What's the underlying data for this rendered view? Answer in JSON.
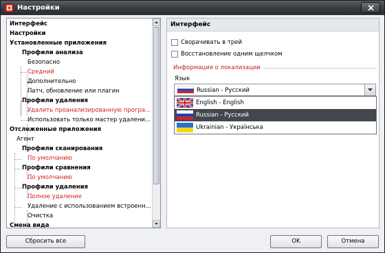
{
  "window": {
    "title": "Настройки"
  },
  "tree": {
    "items": [
      {
        "label": "Интерфейс",
        "style": "b"
      },
      {
        "label": "Настройки",
        "style": "b"
      },
      {
        "label": "Установленные приложения",
        "style": "b"
      },
      {
        "label": "Профили анализа",
        "style": "b"
      },
      {
        "label": "Безопасно",
        "style": ""
      },
      {
        "label": "Средний",
        "style": "red"
      },
      {
        "label": "Дополнительно",
        "style": ""
      },
      {
        "label": "Патч, обновление или плагин",
        "style": ""
      },
      {
        "label": "Профили удаления",
        "style": "b"
      },
      {
        "label": "Удалить проанализированную програ...",
        "style": "red"
      },
      {
        "label": "Использовать только мастер удалени...",
        "style": ""
      },
      {
        "label": "Отслеженные приложения",
        "style": "b"
      },
      {
        "label": "Агент",
        "style": ""
      },
      {
        "label": "Профили сканирования",
        "style": "b"
      },
      {
        "label": "По умолчанию",
        "style": "red"
      },
      {
        "label": "Профили сравнения",
        "style": "b"
      },
      {
        "label": "По умолчанию",
        "style": "red"
      },
      {
        "label": "Профили удаления",
        "style": "b"
      },
      {
        "label": "Полное удаление",
        "style": "red"
      },
      {
        "label": "Удаление с использованием встроенн...",
        "style": ""
      },
      {
        "label": "Очистка",
        "style": ""
      },
      {
        "label": "Смена вида",
        "style": "b"
      }
    ]
  },
  "panel": {
    "title": "Интерфейс",
    "checkbox_tray": "Сворачивать в трей",
    "checkbox_restore": "Восстановление одним щелчком",
    "group_title": "Информация о локализации",
    "language_label": "Язык",
    "language_selected": "Russian - Русский",
    "language_options": [
      "English - English",
      "Russian - Русский",
      "Ukrainian - Українська"
    ],
    "selected_index": 1
  },
  "buttons": {
    "reset": "Сбросить все",
    "ok": "OK",
    "cancel": "Отмена"
  },
  "colors": {
    "accent_red": "#d42020",
    "selection": "#44484e",
    "titlebar": "#35383c"
  },
  "icons": {
    "app": "settings-app-icon",
    "close": "close-icon",
    "combo": "chevron-down-icon",
    "flags": [
      "uk-flag-icon",
      "russia-flag-icon",
      "ukraine-flag-icon"
    ]
  }
}
